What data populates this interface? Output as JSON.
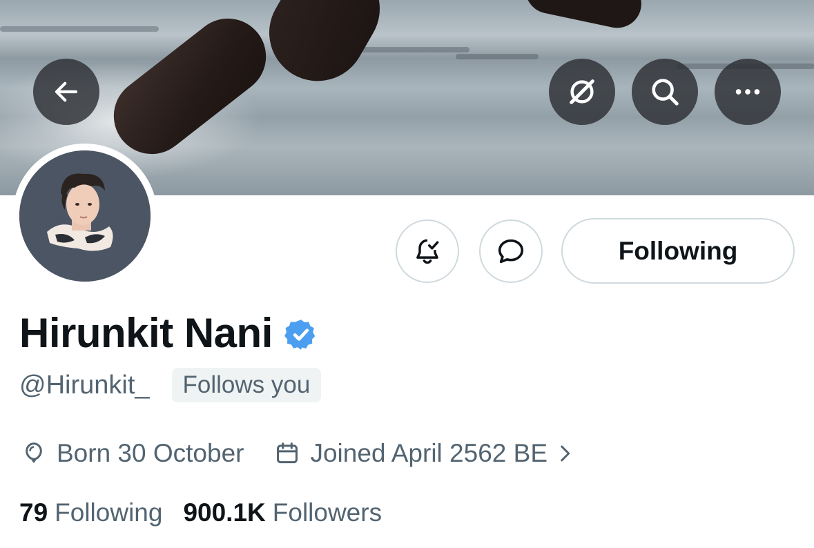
{
  "header": {
    "back_icon": "arrow-left-icon",
    "translate_icon": "grok-slash-icon",
    "search_icon": "search-icon",
    "more_icon": "more-horizontal-icon"
  },
  "profile": {
    "display_name": "Hirunkit Nani",
    "verified": true,
    "verified_color": "#4c9ff0",
    "handle": "@Hirunkit_",
    "follows_you_label": "Follows you",
    "birthday": "Born 30 October",
    "joined": "Joined April 2562 BE"
  },
  "actions": {
    "notify_icon": "bell-check-icon",
    "message_icon": "message-bubble-icon",
    "following_label": "Following"
  },
  "stats": {
    "following_count": "79",
    "following_label": "Following",
    "followers_count": "900.1K",
    "followers_label": "Followers"
  }
}
